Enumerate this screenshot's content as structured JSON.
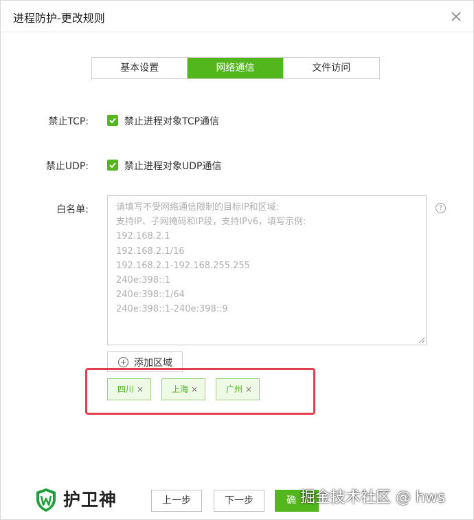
{
  "window": {
    "title": "进程防护-更改规则"
  },
  "tabs": [
    {
      "label": "基本设置",
      "active": false
    },
    {
      "label": "网络通信",
      "active": true
    },
    {
      "label": "文件访问",
      "active": false
    }
  ],
  "tcp": {
    "label": "禁止TCP:",
    "checkbox_text": "禁止进程对象TCP通信",
    "checked": true
  },
  "udp": {
    "label": "禁止UDP:",
    "checkbox_text": "禁止进程对象UDP通信",
    "checked": true
  },
  "whitelist": {
    "label": "白名单:",
    "placeholder": "请填写不受网络通信限制的目标IP和区域:\n支持IP、子网掩码和IP段，支持IPv6，填写示例:\n192.168.2.1\n192.168.2.1/16\n192.168.2.1-192.168.255.255\n240e:398::1\n240e:398::1/64\n240e:398::1-240e:398::9",
    "help_icon": "?"
  },
  "add_region": {
    "label": "添加区域"
  },
  "regions": [
    {
      "name": "四川",
      "remove": "×"
    },
    {
      "name": "上海",
      "remove": "×"
    },
    {
      "name": "广州",
      "remove": "×"
    }
  ],
  "footer": {
    "brand": "护卫神",
    "prev_label": "上一步",
    "next_label": "下一步",
    "confirm_label": "确"
  },
  "watermark": "掘金技术社区 @ hws",
  "colors": {
    "accent": "#52b61c",
    "highlight": "#e0404a"
  },
  "icons": {
    "close": "close-icon",
    "checkbox": "check-icon",
    "help": "help-icon",
    "add": "plus-circle-icon",
    "logo": "shield-w-icon"
  }
}
